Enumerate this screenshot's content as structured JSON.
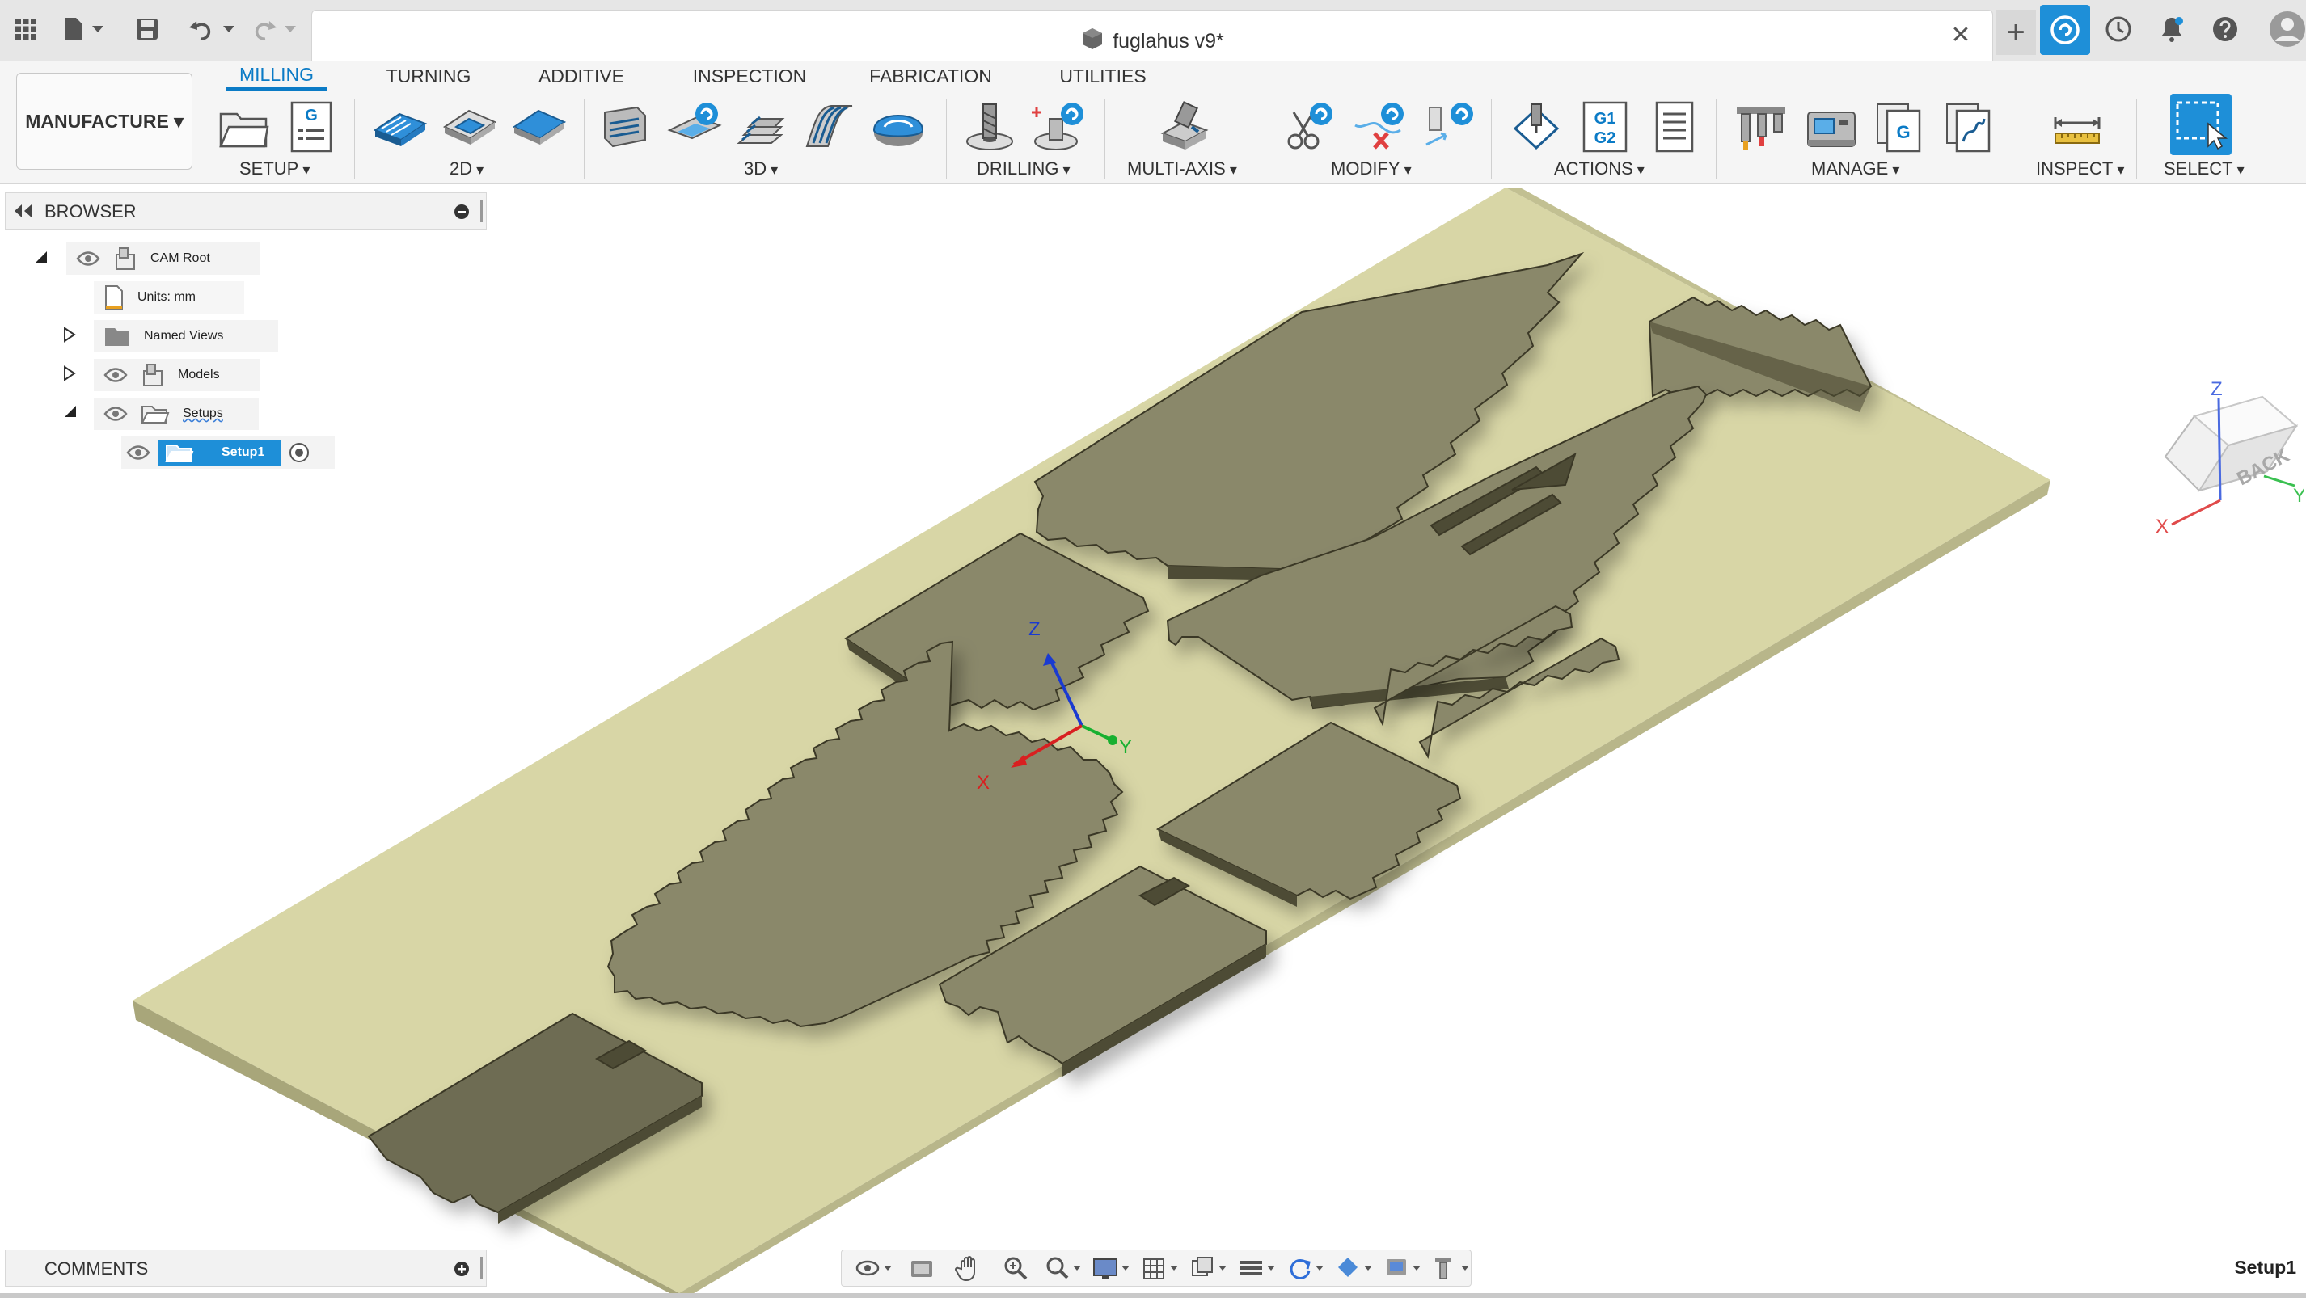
{
  "window": {
    "title": "fuglahus v9*",
    "close_glyph": "✕",
    "new_tab_glyph": "+"
  },
  "workspace": {
    "label": "MANUFACTURE ▾"
  },
  "tabs": [
    {
      "label": "MILLING",
      "active": true
    },
    {
      "label": "TURNING",
      "active": false
    },
    {
      "label": "ADDITIVE",
      "active": false
    },
    {
      "label": "INSPECTION",
      "active": false
    },
    {
      "label": "FABRICATION",
      "active": false
    },
    {
      "label": "UTILITIES",
      "active": false
    }
  ],
  "groups": {
    "setup": "SETUP",
    "twod": "2D",
    "threed": "3D",
    "drilling": "DRILLING",
    "multiaxis": "MULTI-AXIS",
    "modify": "MODIFY",
    "actions": "ACTIONS",
    "manage": "MANAGE",
    "inspect": "INSPECT",
    "select": "SELECT"
  },
  "actions_g1g2": {
    "line1": "G1",
    "line2": "G2"
  },
  "browser": {
    "title": "BROWSER",
    "nodes": {
      "root": "CAM Root",
      "units": "Units: mm",
      "named_views": "Named Views",
      "models": "Models",
      "setups": "Setups",
      "setup1": "Setup1"
    }
  },
  "viewport": {
    "axis_labels": {
      "x": "X",
      "y": "Y",
      "z": "Z"
    },
    "viewcube": {
      "face": "BACK",
      "x": "X",
      "y": "Y",
      "z": "Z"
    }
  },
  "comments": {
    "title": "COMMENTS"
  },
  "status": {
    "active_setup": "Setup1"
  },
  "colors": {
    "accent": "#0b7bc6",
    "stock": "#d8d6a6",
    "part_top": "#8a886a",
    "part_side": "#4e4c36"
  }
}
